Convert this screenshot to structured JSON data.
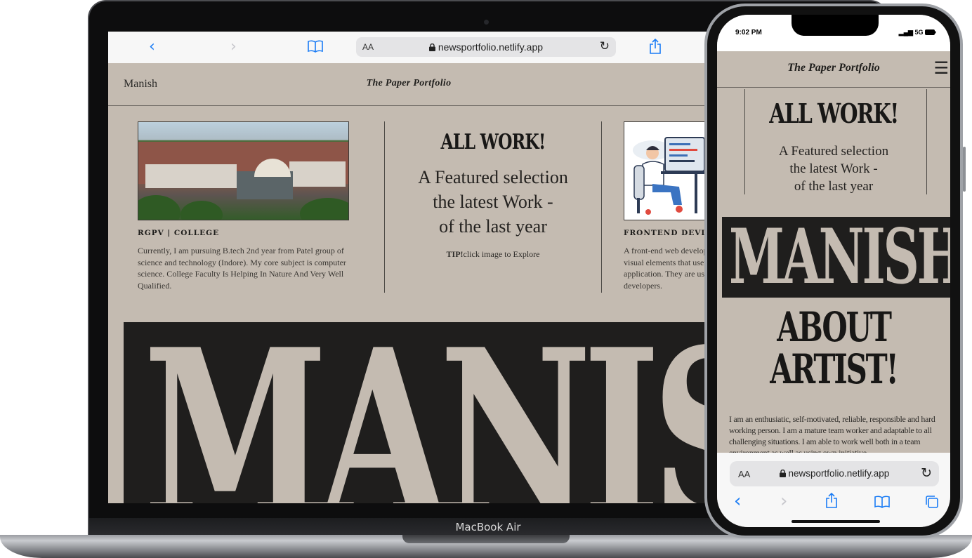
{
  "laptop": {
    "model_label": "MacBook Air",
    "browser": {
      "back_icon": "‹",
      "forward_icon": "›",
      "bookmarks_icon": "book-icon",
      "text_size_label": "AA",
      "url": "newsportfolio.netlify.app",
      "reload_icon": "↻",
      "share_icon": "share-icon"
    },
    "site": {
      "name": "Manish",
      "logo": "The Paper Portfolio",
      "college_card": {
        "title": "RGPV | COLLEGE",
        "text": "Currently, I am pursuing B.tech 2nd year from Patel group of science and technology (Indore). My core subject is computer science. College Faculty Is Helping In Nature And Very Well Qualified."
      },
      "hero": {
        "heading": "ALL WORK!",
        "subtitle_line1": "A Featured selection",
        "subtitle_line2": "the latest Work -",
        "subtitle_line3": "of the last year",
        "tip_label": "TIP!",
        "tip_text": "click image to Explore"
      },
      "dev_card": {
        "title": "FRONTEND DEVLOPER |",
        "text": "A front-end web develop visual elements that user application. They are usu developers."
      },
      "banner_text": "MANISH"
    }
  },
  "phone": {
    "time": "9:02 PM",
    "signal": "5G",
    "site": {
      "logo": "The Paper Portfolio",
      "menu_icon": "☰",
      "heading": "ALL WORK!",
      "subtitle_line1": "A Featured selection",
      "subtitle_line2": "the latest Work -",
      "subtitle_line3": "of the last year",
      "banner_text": "MANISH",
      "about_line1": "ABOUT",
      "about_line2": "ARTIST!",
      "about_text": "I am an enthusiatic, self-motivated, reliable, responsible and hard working person. I am a mature team worker and adaptable to all challenging situations. I am able to work well both in a team environment as well as using own initiative."
    },
    "browser": {
      "text_size_label": "AA",
      "url": "newsportfolio.netlify.app",
      "reload_icon": "↻",
      "back_icon": "‹",
      "forward_icon": "›",
      "share_icon": "share-icon",
      "bookmarks_icon": "book-icon",
      "tabs_icon": "tabs-icon"
    }
  },
  "colors": {
    "paper": "#c4bbb1",
    "ink": "#1f1e1d",
    "safari_blue": "#1a7cf5"
  }
}
